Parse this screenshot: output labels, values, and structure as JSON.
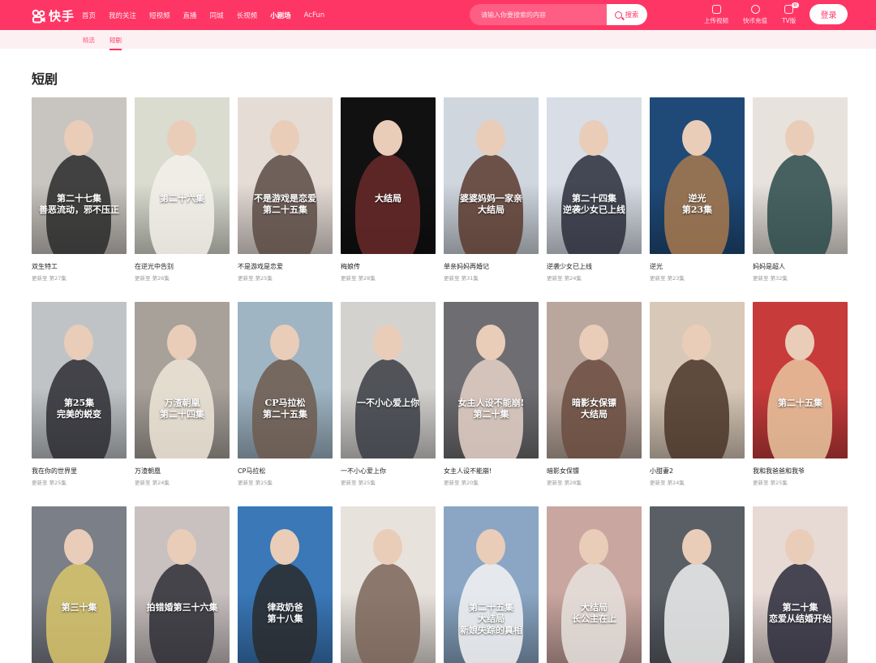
{
  "header": {
    "brand": "快手",
    "nav": [
      "首页",
      "我的关注",
      "短视频",
      "直播",
      "同城",
      "长视频",
      "小剧场",
      "AcFun"
    ],
    "active_nav": 6,
    "search_placeholder": "请输入你要搜索的内容",
    "search_label": "搜索",
    "tools": [
      "上传视频",
      "快币充值",
      "TV版"
    ],
    "tv_badge": "新",
    "login_label": "登录",
    "brand_color": "#fe3666"
  },
  "subnav": {
    "tabs": [
      "精选",
      "短剧"
    ],
    "active": 1
  },
  "page_title": "短剧",
  "cards": [
    {
      "title": "双生特工",
      "meta": "更新至 第27集",
      "caption": "第二十七集\n善恶流动，邪不压正",
      "bg": "#c8c4bf",
      "tone": "#2a2a2a"
    },
    {
      "title": "在逆光中告别",
      "meta": "更新至 第26集",
      "caption": "第二十六集",
      "bg": "#d9dccf",
      "tone": "#f3f0ea"
    },
    {
      "title": "不是游戏是恋爱",
      "meta": "更新至 第25集",
      "caption": "不是游戏是恋爱\n第二十五集",
      "bg": "#e6dcd6",
      "tone": "#5b4a44"
    },
    {
      "title": "梅娘传",
      "meta": "更新至 第28集",
      "caption": "大结局",
      "bg": "#111111",
      "tone": "#6b2a2a"
    },
    {
      "title": "单亲妈妈再婚记",
      "meta": "更新至 第31集",
      "caption": "婆婆妈妈一家亲\n大结局",
      "bg": "#cfd6de",
      "tone": "#5a3a2e"
    },
    {
      "title": "逆袭少女已上线",
      "meta": "更新至 第24集",
      "caption": "第二十四集\n逆袭少女已上线",
      "bg": "#d8dde6",
      "tone": "#2a2d3a"
    },
    {
      "title": "逆光",
      "meta": "更新至 第23集",
      "caption": "逆光\n第23集",
      "bg": "#1f4a78",
      "tone": "#a8794e"
    },
    {
      "title": "妈妈是超人",
      "meta": "更新至 第32集",
      "caption": "",
      "bg": "#e8e2dc",
      "tone": "#2a4a4a"
    },
    {
      "title": "我在你的世界里",
      "meta": "更新至 第25集",
      "caption": "第25集\n完美的蜕变",
      "bg": "#bfc3c6",
      "tone": "#2d2d33"
    },
    {
      "title": "万渣朝凰",
      "meta": "更新至 第24集",
      "caption": "万渣朝凰\n第二十四集",
      "bg": "#a8a19a",
      "tone": "#efe6d8"
    },
    {
      "title": "CP马拉松",
      "meta": "更新至 第25集",
      "caption": "CP马拉松\n第二十五集",
      "bg": "#9fb5c4",
      "tone": "#6d5a4e"
    },
    {
      "title": "一不小心爱上你",
      "meta": "更新至 第25集",
      "caption": "一不小心爱上你",
      "bg": "#d4d2cf",
      "tone": "#3a3d44"
    },
    {
      "title": "女主人设不能崩!",
      "meta": "更新至 第20集",
      "caption": "女主人设不能崩!\n第二十集",
      "bg": "#6e6e72",
      "tone": "#e5d2c8"
    },
    {
      "title": "暗影女保镖",
      "meta": "更新至 第28集",
      "caption": "暗影女保镖\n大结局",
      "bg": "#b9a79d",
      "tone": "#6b4c3f"
    },
    {
      "title": "小甜妻2",
      "meta": "更新至 第24集",
      "caption": "",
      "bg": "#d8c8b8",
      "tone": "#4a3428"
    },
    {
      "title": "我和我爸爸和我爷",
      "meta": "更新至 第25集",
      "caption": "第二十五集",
      "bg": "#c73b3b",
      "tone": "#e9c7a0"
    },
    {
      "title": "",
      "meta": "",
      "caption": "第三十集",
      "bg": "#7a7f88",
      "tone": "#d9c56a"
    },
    {
      "title": "",
      "meta": "",
      "caption": "拍错婚第三十六集",
      "bg": "#c9c0c0",
      "tone": "#2e2e35"
    },
    {
      "title": "",
      "meta": "",
      "caption": "律政奶爸\n第十八集",
      "bg": "#3a78b8",
      "tone": "#2a2a2a"
    },
    {
      "title": "",
      "meta": "",
      "caption": "",
      "bg": "#e8e2dc",
      "tone": "#7a6458"
    },
    {
      "title": "",
      "meta": "",
      "caption": "第二十五集\n大结局\n新娘失踪的真相",
      "bg": "#8aa6c4",
      "tone": "#f5f5f5"
    },
    {
      "title": "",
      "meta": "",
      "caption": "大结局\n长公主在上",
      "bg": "#caa6a0",
      "tone": "#e6e2dd"
    },
    {
      "title": "",
      "meta": "",
      "caption": "",
      "bg": "#5a5f66",
      "tone": "#f0f0f0"
    },
    {
      "title": "",
      "meta": "",
      "caption": "第二十集\n恋爱从结婚开始",
      "bg": "#e7d9d4",
      "tone": "#2a2a3a"
    }
  ]
}
